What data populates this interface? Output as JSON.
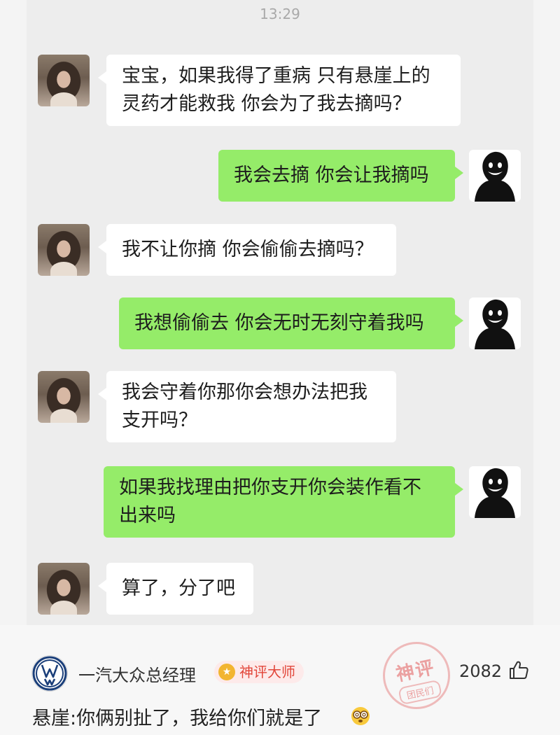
{
  "chat": {
    "time": "13:29",
    "messages": [
      {
        "side": "left",
        "lines": [
          "宝宝，如果我得了重病 只有悬崖上的",
          "灵药才能救我 你会为了我去摘吗？"
        ]
      },
      {
        "side": "right",
        "lines": [
          "我会去摘 你会让我摘吗"
        ]
      },
      {
        "side": "left",
        "lines": [
          "我不让你摘 你会偷偷去摘吗？"
        ]
      },
      {
        "side": "right",
        "lines": [
          "我想偷偷去 你会无时无刻守着我吗"
        ]
      },
      {
        "side": "left",
        "lines": [
          "我会守着你那你会想办法把我",
          "支开吗？"
        ]
      },
      {
        "side": "right",
        "lines": [
          "如果我找理由把你支开你会装作看不",
          "出来吗"
        ]
      },
      {
        "side": "left",
        "lines": [
          "算了，分了吧"
        ]
      }
    ]
  },
  "comment": {
    "username": "一汽大众总经理",
    "badge": "神评大师",
    "stamp_top": "神评",
    "stamp_bottom": "团民们",
    "likes": "2082",
    "text": "悬崖:你俩别扯了，我给你们就是了"
  },
  "colors": {
    "bubble_out": "#95ec69",
    "bubble_in": "#ffffff",
    "chat_background": "#ededed",
    "badge_text": "#e2463a"
  },
  "icons": [
    "girl-avatar",
    "shadow-avatar",
    "vw-logo-icon",
    "badge-medal-icon",
    "thumbs-up-icon",
    "dizzy-eyes-emoji-icon"
  ]
}
